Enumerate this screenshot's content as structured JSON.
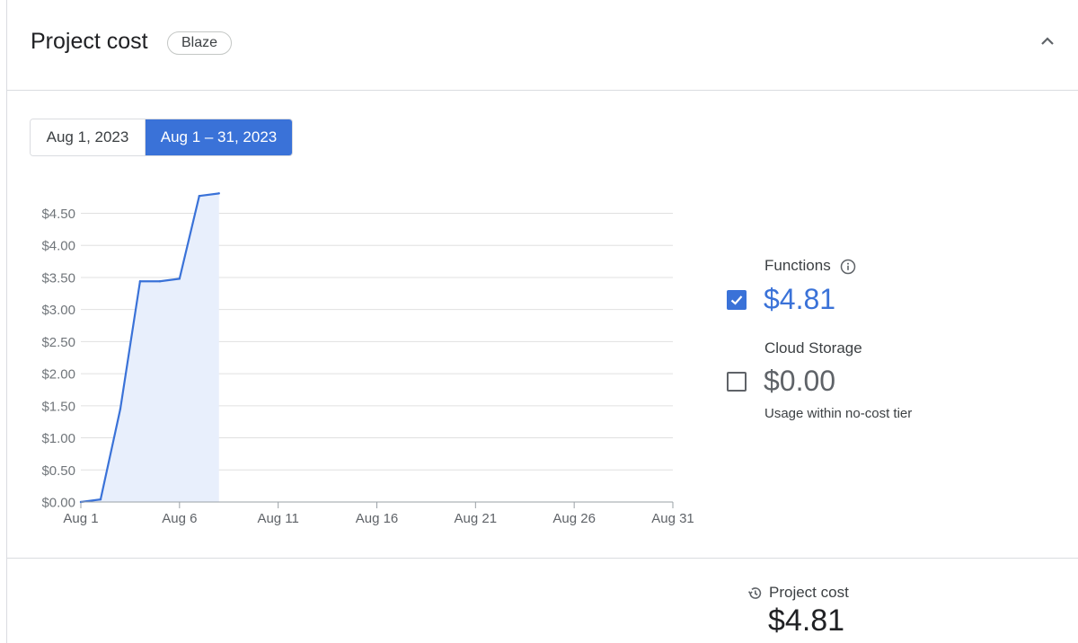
{
  "header": {
    "title": "Project cost",
    "plan_badge": "Blaze"
  },
  "date_range_toggle": {
    "options": [
      "Aug 1, 2023",
      "Aug 1 – 31, 2023"
    ],
    "selected": "Aug 1 – 31, 2023"
  },
  "chart_data": {
    "type": "area",
    "title": "",
    "xlabel": "",
    "ylabel": "",
    "x_ticks": [
      "Aug 1",
      "Aug 6",
      "Aug 11",
      "Aug 16",
      "Aug 21",
      "Aug 26",
      "Aug 31"
    ],
    "y_ticks": [
      "$0.00",
      "$0.50",
      "$1.00",
      "$1.50",
      "$2.00",
      "$2.50",
      "$3.00",
      "$3.50",
      "$4.00",
      "$4.50"
    ],
    "xlim": [
      1,
      31
    ],
    "ylim": [
      0,
      4.5
    ],
    "grid": true,
    "series": [
      {
        "x": [
          1,
          2,
          3,
          4,
          5,
          6,
          7,
          8
        ],
        "values": [
          0.0,
          0.04,
          1.45,
          3.44,
          3.44,
          3.48,
          4.77,
          4.81
        ],
        "color": "#3a72d8",
        "fill": "#e8effc"
      }
    ]
  },
  "legend": {
    "functions": {
      "label": "Functions",
      "value": "$4.81",
      "checked": true,
      "color": "#3a72d8"
    },
    "cloud_storage": {
      "label": "Cloud Storage",
      "value": "$0.00",
      "checked": false,
      "note": "Usage within no-cost tier",
      "color": "#5f6368"
    }
  },
  "footer": {
    "label": "Project cost",
    "value": "$4.81"
  },
  "icons": {
    "collapse": "chevron-up-icon",
    "info": "info-icon",
    "history": "history-icon",
    "check": "check-icon"
  }
}
